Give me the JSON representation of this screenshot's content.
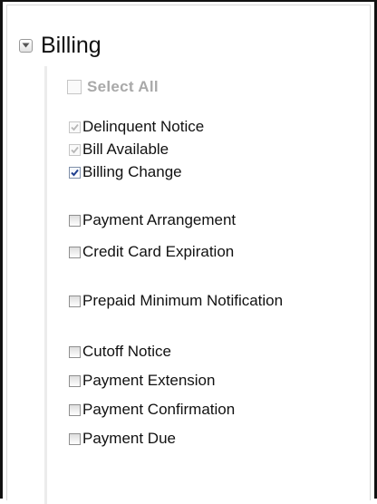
{
  "section": {
    "title": "Billing",
    "expanded": true,
    "toggle_icon": "collapse-arrow-icon"
  },
  "select_all": {
    "label": "Select All",
    "checked": false,
    "enabled": false
  },
  "options": [
    {
      "label": "Delinquent Notice",
      "checked": true,
      "enabled": false
    },
    {
      "label": "Bill Available",
      "checked": true,
      "enabled": false
    },
    {
      "label": "Billing Change",
      "checked": true,
      "enabled": true
    },
    {
      "label": "Payment Arrangement",
      "checked": false,
      "enabled": true
    },
    {
      "label": "Credit Card Expiration",
      "checked": false,
      "enabled": true
    },
    {
      "label": "Prepaid Minimum Notification",
      "checked": false,
      "enabled": true
    },
    {
      "label": "Cutoff Notice",
      "checked": false,
      "enabled": true
    },
    {
      "label": "Payment Extension",
      "checked": false,
      "enabled": true
    },
    {
      "label": "Payment Confirmation",
      "checked": false,
      "enabled": true
    },
    {
      "label": "Payment Due",
      "checked": false,
      "enabled": true
    }
  ],
  "colors": {
    "check_enabled": "#1f3f8f",
    "check_disabled": "#b7b7b7",
    "select_all_text": "#a9a9a9"
  }
}
